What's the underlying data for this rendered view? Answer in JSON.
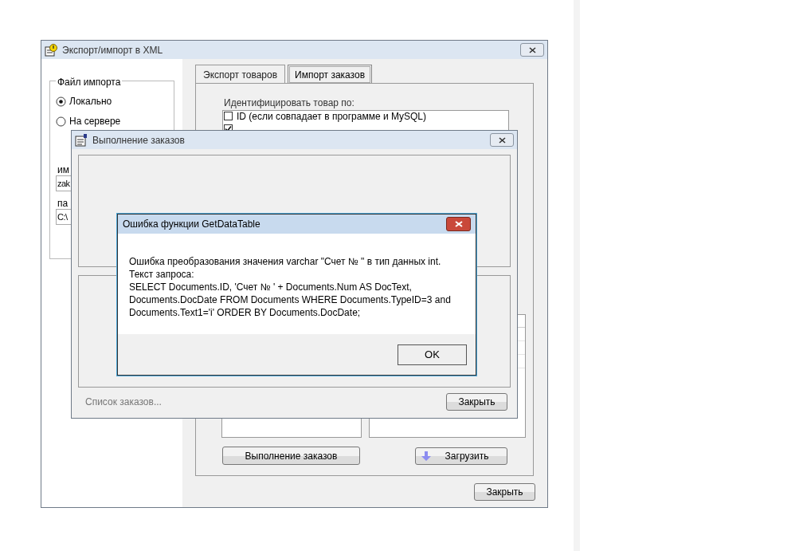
{
  "main_window": {
    "title": "Экспорт/импорт в XML",
    "file_group": {
      "title": "Файл импорта",
      "options": [
        {
          "label": "Локально",
          "selected": true
        },
        {
          "label": "На сервере",
          "selected": false
        }
      ],
      "name_label": "им",
      "name_value": "zak",
      "folder_label": "па",
      "folder_value": "C:\\"
    },
    "tabs": [
      {
        "label": "Экспорт товаров",
        "selected": false
      },
      {
        "label": "Импорт заказов",
        "selected": true
      }
    ],
    "identify_label": "Идентифицировать товар по:",
    "identify_options": [
      {
        "label": "ID  (если совпадает в программе и MySQL)",
        "checked": false
      },
      {
        "checked": true
      }
    ],
    "buttons": {
      "orders": "Выполнение заказов",
      "load": "Загрузить",
      "close": "Закрыть"
    }
  },
  "orders_window": {
    "title": "Выполнение заказов",
    "status": "Список заказов...",
    "close": "Закрыть"
  },
  "error_dialog": {
    "title": "Ошибка функции GetDataTable",
    "lines": [
      "Ошибка преобразования значения varchar \"Счет № \" в тип данных int.",
      "Текст запроса:",
      "SELECT Documents.ID, 'Счет № ' + Documents.Num AS DocText,",
      "Documents.DocDate FROM Documents WHERE Documents.TypeID=3 and",
      "Documents.Text1='i' ORDER BY Documents.DocDate;"
    ],
    "ok": "OK"
  }
}
